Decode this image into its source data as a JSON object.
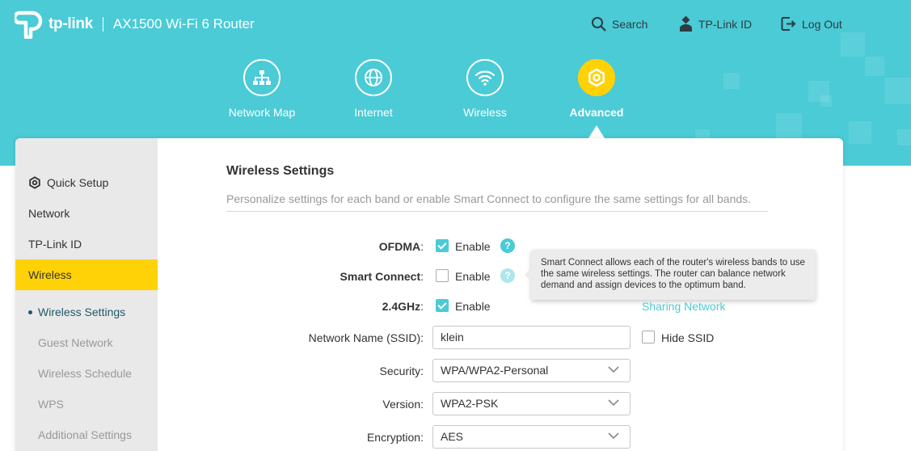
{
  "header": {
    "brand": "tp-link",
    "model": "AX1500 Wi-Fi 6 Router",
    "search": "Search",
    "tplink_id": "TP-Link ID",
    "logout": "Log Out"
  },
  "mainnav": [
    {
      "label": "Network Map",
      "icon": "network-map-icon"
    },
    {
      "label": "Internet",
      "icon": "globe-icon"
    },
    {
      "label": "Wireless",
      "icon": "wifi-icon"
    },
    {
      "label": "Advanced",
      "icon": "gear-icon",
      "active": true
    }
  ],
  "sidebar": {
    "items": [
      {
        "label": "Quick Setup",
        "icon": "gear-icon"
      },
      {
        "label": "Network"
      },
      {
        "label": "TP-Link ID"
      },
      {
        "label": "Wireless",
        "active": true
      }
    ],
    "subitems": [
      {
        "label": "Wireless Settings",
        "active": true
      },
      {
        "label": "Guest Network"
      },
      {
        "label": "Wireless Schedule"
      },
      {
        "label": "WPS"
      },
      {
        "label": "Additional Settings"
      }
    ]
  },
  "main": {
    "title": "Wireless Settings",
    "description": "Personalize settings for each band or enable Smart Connect to configure the same settings for all bands.",
    "ofdma_label": "OFDMA",
    "smart_connect_label": "Smart Connect",
    "band_label": "2.4GHz",
    "colon": ":",
    "enable": "Enable",
    "help_mark": "?",
    "tooltip": "Smart Connect allows each of the router's wireless bands to use the same wireless settings. The router can balance network demand and assign devices to the optimum band.",
    "sharing_link": "Sharing Network",
    "ssid_label": "Network Name (SSID):",
    "ssid_value": "klein",
    "hide_ssid": "Hide SSID",
    "security_label": "Security:",
    "security_value": "WPA/WPA2-Personal",
    "version_label": "Version:",
    "version_value": "WPA2-PSK",
    "encryption_label": "Encryption:",
    "encryption_value": "AES"
  },
  "state": {
    "ofdma_enabled": true,
    "smart_connect_enabled": false,
    "band_enabled": true,
    "hide_ssid": false
  },
  "colors": {
    "header_bg": "#4acbd6",
    "accent": "#ffd208",
    "sidebar_bg": "#e9e9e9"
  }
}
